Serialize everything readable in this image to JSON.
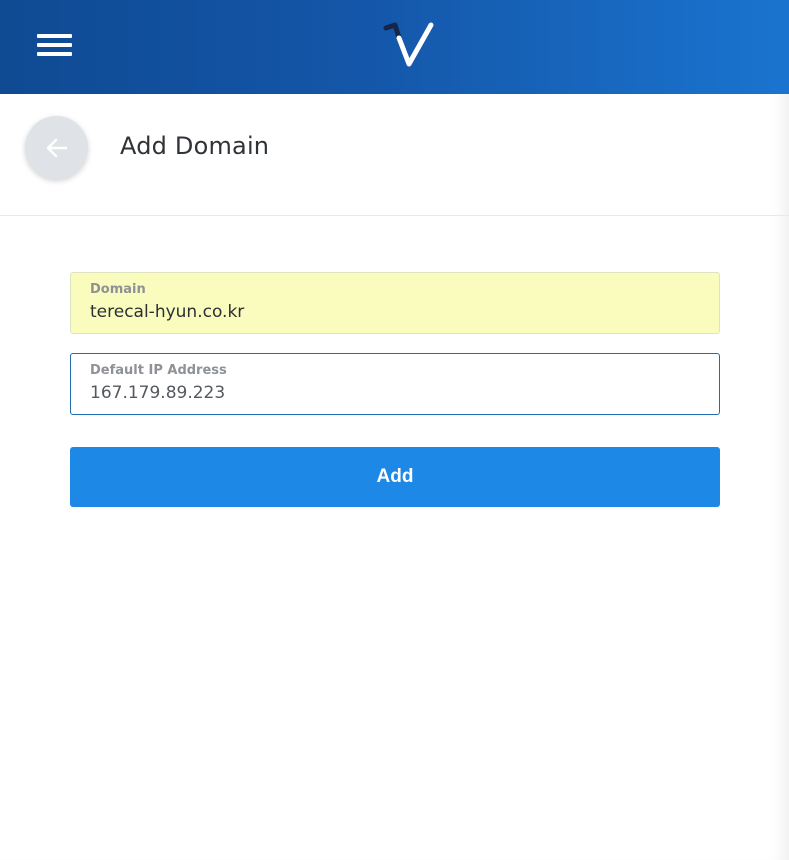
{
  "header": {
    "menu_icon": "hamburger-menu-icon",
    "logo_icon": "brand-checkmark-logo-icon",
    "colors": {
      "gradient_start": "#0f4a93",
      "gradient_end": "#1a74cf"
    }
  },
  "title_bar": {
    "back_icon": "arrow-left-icon",
    "title": "Add Domain"
  },
  "form": {
    "domain": {
      "label": "Domain",
      "value": "terecal-hyun.co.kr"
    },
    "ip": {
      "label": "Default IP Address",
      "value": "167.179.89.223"
    },
    "submit_label": "Add",
    "accent_color": "#1d88e5"
  }
}
